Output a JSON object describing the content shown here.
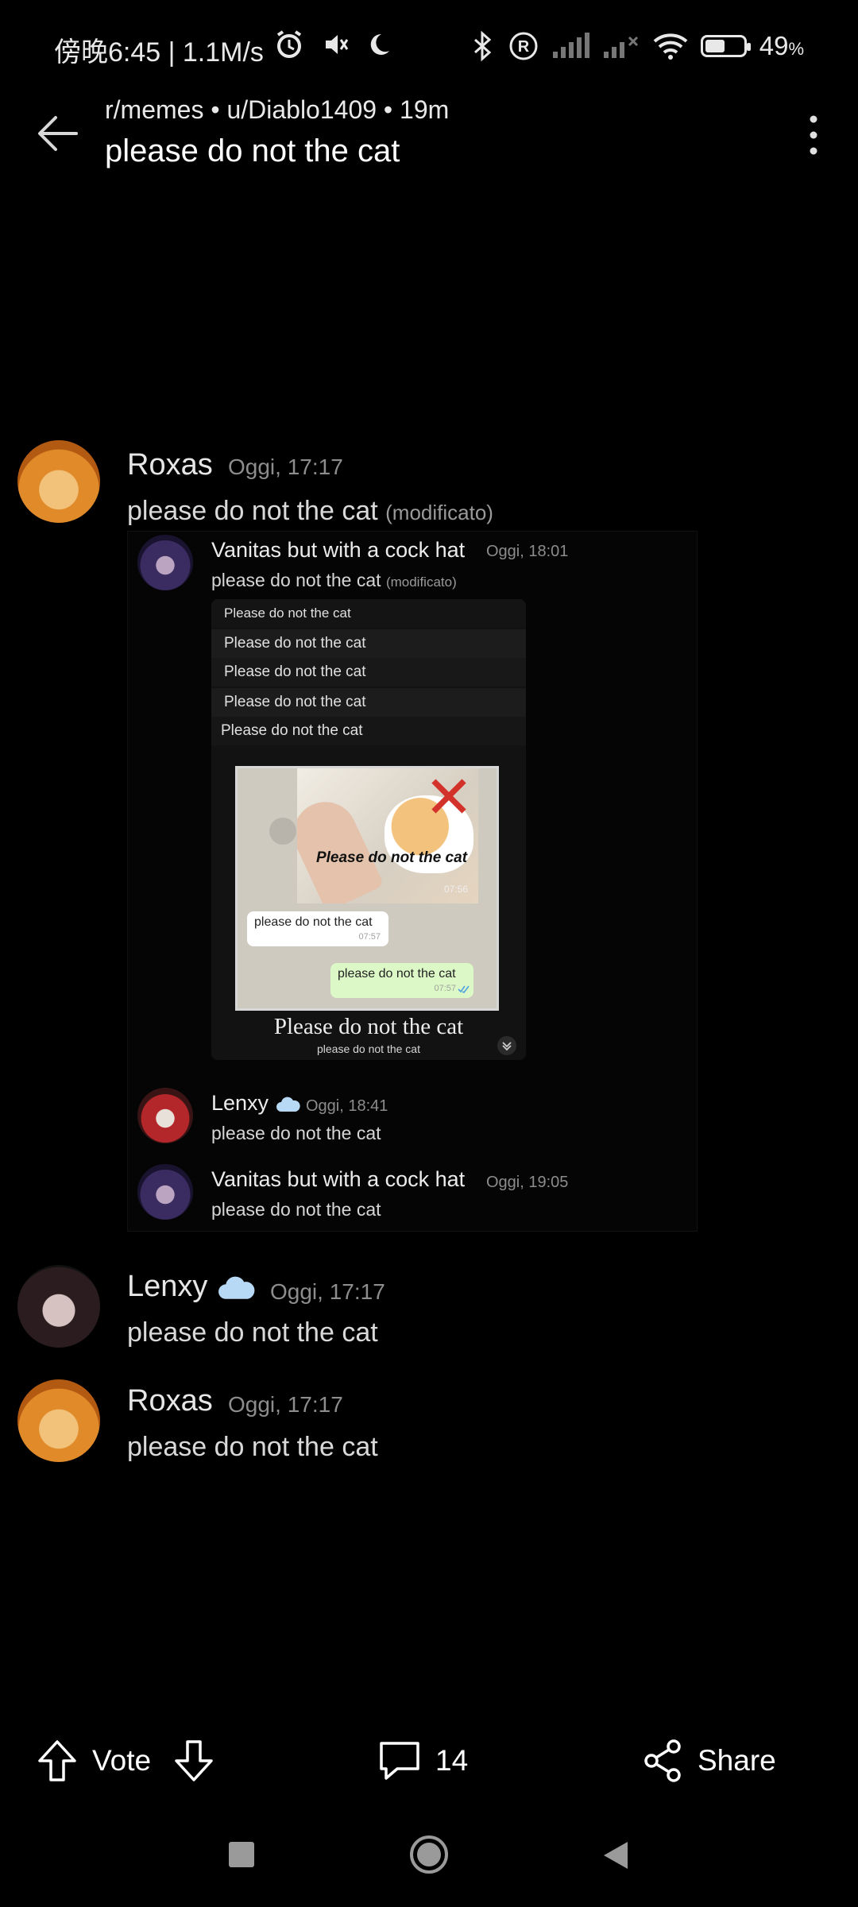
{
  "status_bar": {
    "time_text": "傍晚6:45 | 1.1M/s",
    "battery_level": "49",
    "battery_unit": "%",
    "battery_fraction": 0.49
  },
  "header": {
    "meta": "r/memes • u/Diablo1409 • 19m",
    "title": "please do not the cat"
  },
  "post_image": {
    "top_message": {
      "name": "Roxas",
      "time": "Oggi, 17:17",
      "text": "please do not the cat",
      "edited": "(modificato)"
    },
    "inner": {
      "first": {
        "name": "Vanitas but with a cock hat",
        "time": "Oggi, 18:01",
        "text": "please do not the cat",
        "edited": "(modificato)"
      },
      "embed_rows": [
        "Please do not the cat",
        "Please do not the cat",
        "Please do not the cat",
        "Please do not the cat",
        "Please do not the cat"
      ],
      "frame": {
        "photo_caption": "Please do not the cat",
        "photo_time": "07:56",
        "bubble_left_text": "please do not the cat",
        "bubble_left_time": "07:57",
        "bubble_right_text": "please do not the cat",
        "bubble_right_time": "07:57"
      },
      "embed_caption_main": "Please do not the cat",
      "embed_caption_sub": "please do not the cat",
      "second": {
        "name": "Lenxy",
        "time": "Oggi, 18:41",
        "text": "please do not the cat"
      },
      "third": {
        "name": "Vanitas but with a cock hat",
        "time": "Oggi, 19:05",
        "text": "please do not the cat"
      }
    },
    "msg2": {
      "name": "Lenxy",
      "time": "Oggi, 17:17",
      "text": "please do not the cat"
    },
    "msg3": {
      "name": "Roxas",
      "time": "Oggi, 17:17",
      "text": "please do not the cat"
    }
  },
  "actions": {
    "vote": "Vote",
    "comments": "14",
    "share": "Share"
  },
  "icons": {
    "back": "arrow-left-icon",
    "more": "more-vertical-icon",
    "upvote": "arrow-up-icon",
    "downvote": "arrow-down-icon",
    "comment": "comment-icon",
    "share": "share-icon"
  }
}
